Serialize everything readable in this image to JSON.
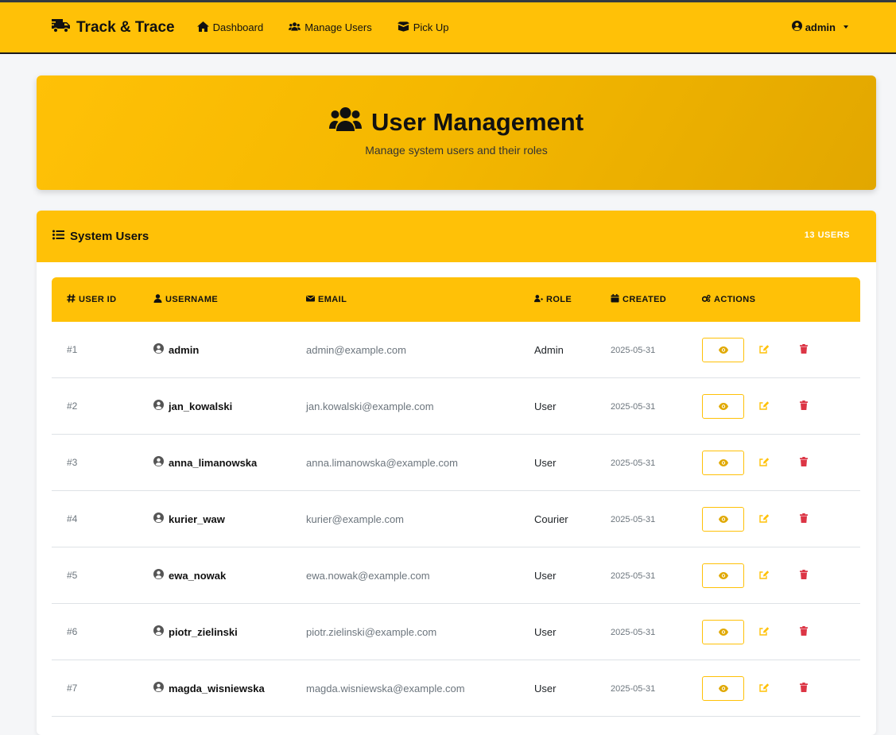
{
  "navbar": {
    "brand": "Track & Trace",
    "items": [
      {
        "label": "Dashboard",
        "icon": "home-icon"
      },
      {
        "label": "Manage Users",
        "icon": "users-icon"
      },
      {
        "label": "Pick Up",
        "icon": "box-icon"
      }
    ],
    "user": "admin"
  },
  "hero": {
    "title": "User Management",
    "subtitle": "Manage system users and their roles"
  },
  "card": {
    "title": "System Users",
    "count": "13 USERS"
  },
  "table": {
    "headers": {
      "id": "USER ID",
      "username": "USERNAME",
      "email": "EMAIL",
      "role": "ROLE",
      "created": "CREATED",
      "actions": "ACTIONS"
    },
    "rows": [
      {
        "id": "#1",
        "username": "admin",
        "email": "admin@example.com",
        "role": "Admin",
        "created": "2025-05-31"
      },
      {
        "id": "#2",
        "username": "jan_kowalski",
        "email": "jan.kowalski@example.com",
        "role": "User",
        "created": "2025-05-31"
      },
      {
        "id": "#3",
        "username": "anna_limanowska",
        "email": "anna.limanowska@example.com",
        "role": "User",
        "created": "2025-05-31"
      },
      {
        "id": "#4",
        "username": "kurier_waw",
        "email": "kurier@example.com",
        "role": "Courier",
        "created": "2025-05-31"
      },
      {
        "id": "#5",
        "username": "ewa_nowak",
        "email": "ewa.nowak@example.com",
        "role": "User",
        "created": "2025-05-31"
      },
      {
        "id": "#6",
        "username": "piotr_zielinski",
        "email": "piotr.zielinski@example.com",
        "role": "User",
        "created": "2025-05-31"
      },
      {
        "id": "#7",
        "username": "magda_wisniewska",
        "email": "magda.wisniewska@example.com",
        "role": "User",
        "created": "2025-05-31"
      }
    ]
  },
  "colors": {
    "accent": "#ffc107",
    "danger": "#dc3545",
    "muted": "#6c757d"
  }
}
